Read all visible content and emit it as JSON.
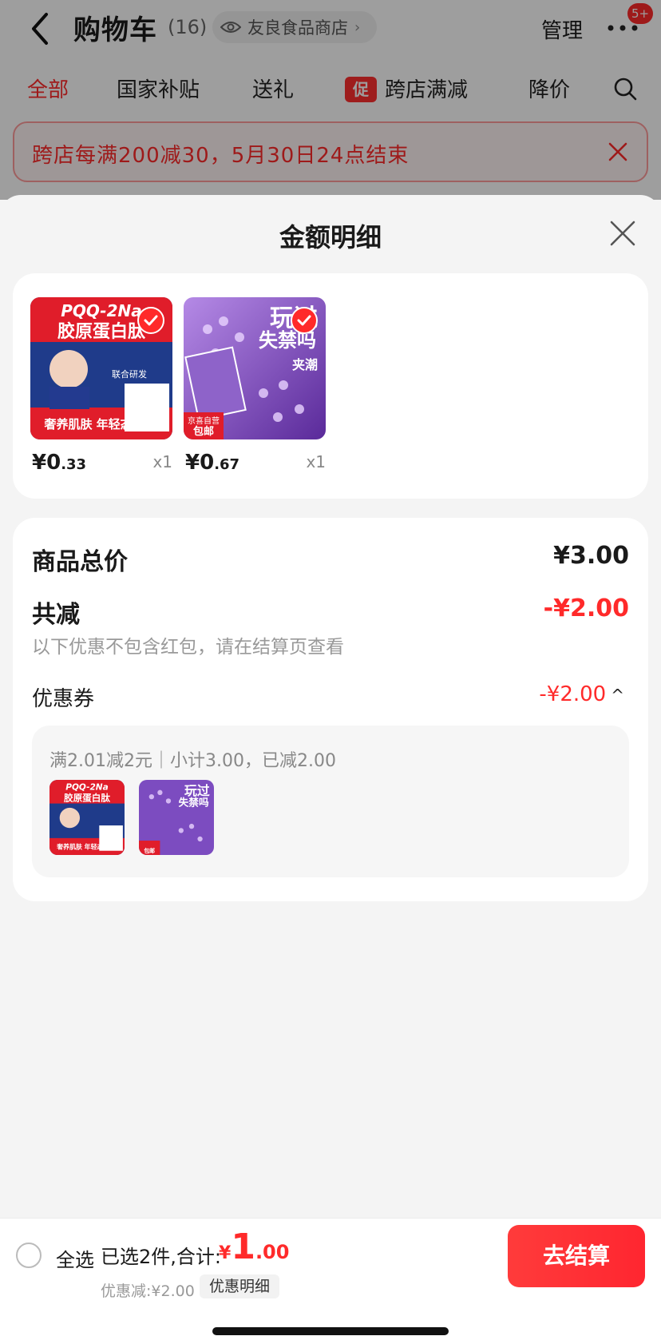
{
  "header": {
    "title": "购物车",
    "count": "(16)",
    "shop_name": "友良食品商店",
    "manage": "管理",
    "more_badge": "5+"
  },
  "tabs": {
    "all": "全部",
    "subsidy": "国家补贴",
    "gift": "送礼",
    "promo_tag": "促",
    "cross_store": "跨店满减",
    "price_drop": "降价"
  },
  "promo_banner": {
    "text": "跨店每满200减30，5月30日24点结束"
  },
  "sheet": {
    "title": "金额明细",
    "products": [
      {
        "price_int": "¥0",
        "price_dec": ".33",
        "qty": "x1",
        "img_lines": [
          "PQQ-2Na",
          "胶原蛋白肽",
          "联合研发",
          "奢养肌肤 年轻态!"
        ]
      },
      {
        "price_int": "¥0",
        "price_dec": ".67",
        "qty": "x1",
        "img_lines": [
          "玩过",
          "失禁吗",
          "夹潮",
          "京喜自营",
          "包邮"
        ]
      }
    ],
    "summary": {
      "total_label": "商品总价",
      "total_value": "¥3.00",
      "reduce_label": "共减",
      "reduce_value": "-¥2.00",
      "note": "以下优惠不包含红包，请在结算页查看",
      "coupon_label": "优惠券",
      "coupon_value": "-¥2.00",
      "coupon_caret": "^",
      "coupon_detail": "满2.01减2元｜小计3.00，已减2.00"
    }
  },
  "bottom_bar": {
    "select_all": "全选",
    "selected_info": "已选2件,合计:",
    "total_yen": "¥",
    "total_int": "1",
    "total_dec": ".00",
    "discount": "优惠减:¥2.00",
    "detail_button": "优惠明细",
    "checkout": "去结算"
  },
  "colors": {
    "accent": "#ff2a2a",
    "overlay": "rgba(0,0,0,0.38)"
  }
}
